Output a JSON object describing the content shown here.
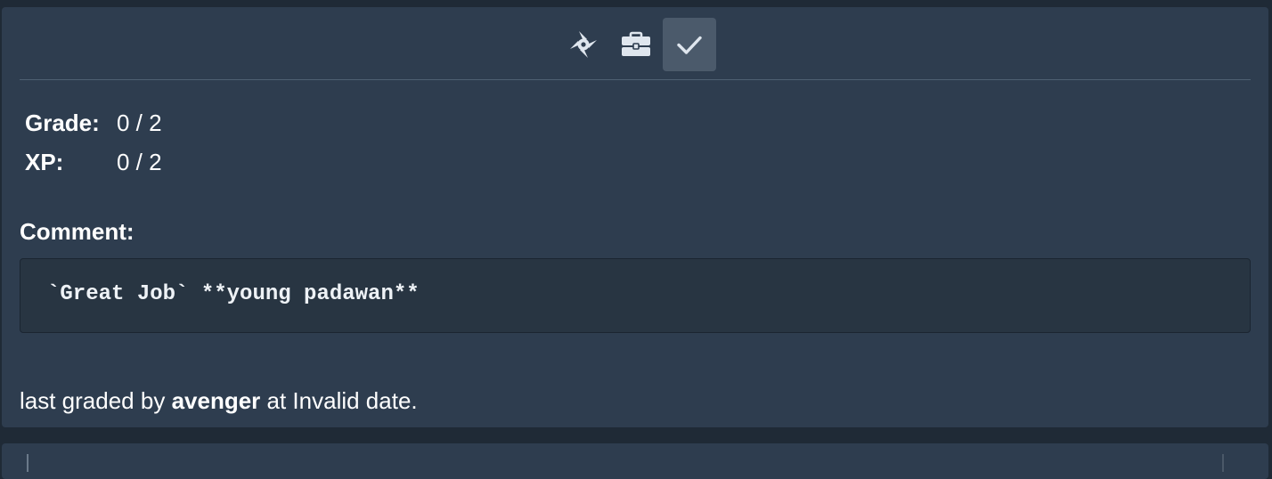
{
  "toolbar": {
    "items": [
      {
        "icon": "shuriken-icon"
      },
      {
        "icon": "briefcase-icon"
      },
      {
        "icon": "check-icon",
        "active": true
      }
    ]
  },
  "grades": {
    "grade_label": "Grade:",
    "grade_value": "0 / 2",
    "xp_label": "XP:",
    "xp_value": "0 / 2"
  },
  "comment": {
    "label": "Comment:",
    "text": "`Great Job` **young padawan**"
  },
  "footer": {
    "prefix": "last graded by ",
    "grader": "avenger",
    "suffix": " at Invalid date."
  },
  "colors": {
    "page_bg": "#1f2a36",
    "card_bg": "#2e3d4f",
    "active_button_bg": "#4b5a6b",
    "comment_bg": "#283542",
    "icon": "#dfe6ee"
  }
}
